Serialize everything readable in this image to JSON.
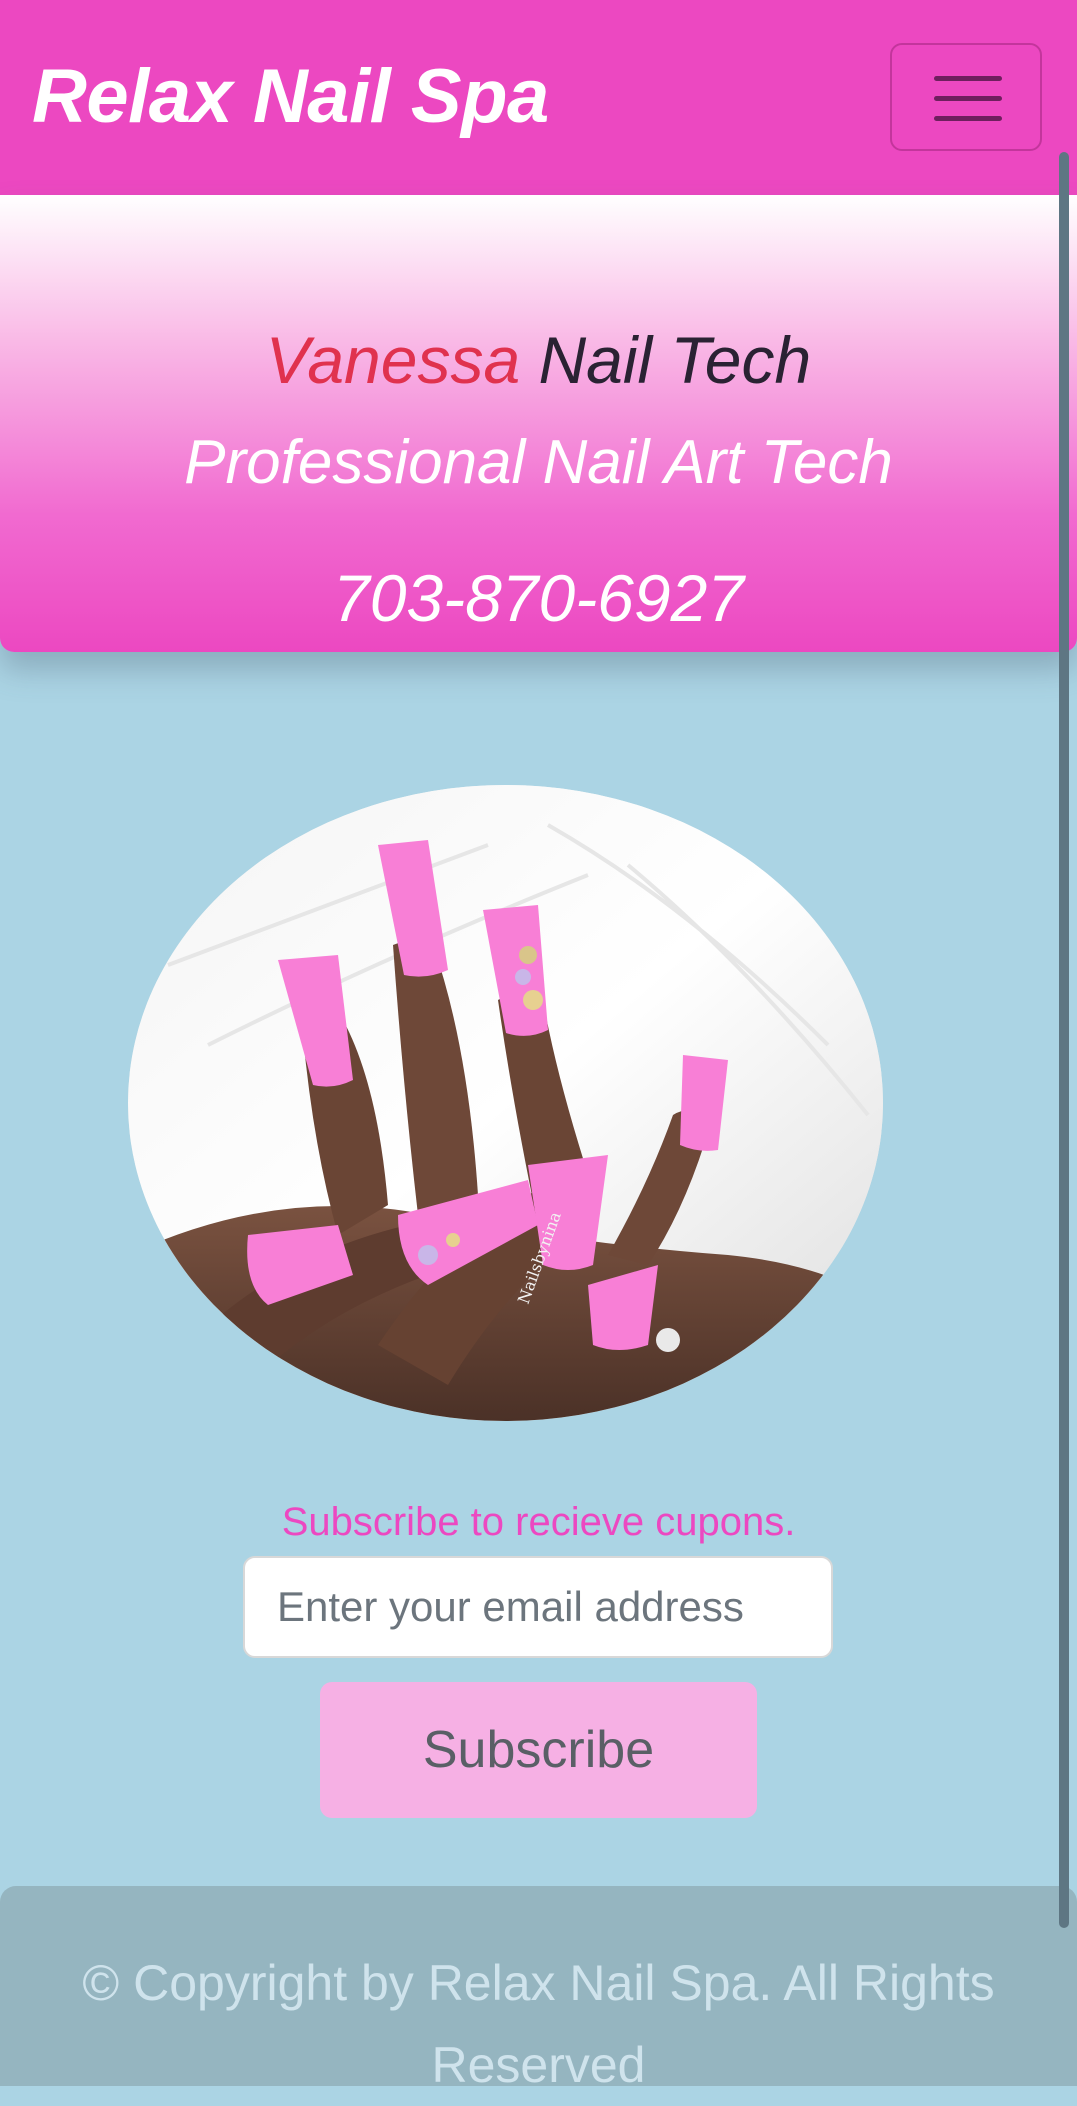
{
  "navbar": {
    "brand": "Relax Nail Spa",
    "menu_icon": "hamburger-menu-icon",
    "color": "#ec48c1"
  },
  "hero": {
    "name_first": "Vanessa",
    "name_rest": "Nail Tech",
    "subtitle": "Professional Nail Art Tech",
    "phone": "703-870-6927",
    "colors": {
      "name_first": "#e0324e",
      "name_rest": "#2a2233",
      "gradient_top": "#ffffff",
      "gradient_bottom": "#ec48c1"
    }
  },
  "photo": {
    "subject": "pink-coffin-nails-photo",
    "watermark": "Nailsbynina"
  },
  "subscribe": {
    "prompt": "Subscribe to recieve cupons.",
    "email_placeholder": "Enter your email address",
    "email_value": "",
    "button_label": "Subscribe"
  },
  "footer": {
    "text": "© Copyright by Relax Nail Spa. All Rights Reserved"
  },
  "theme": {
    "page_background": "#abd4e4",
    "accent": "#ec48c1",
    "button_background": "#f6b0e4"
  }
}
